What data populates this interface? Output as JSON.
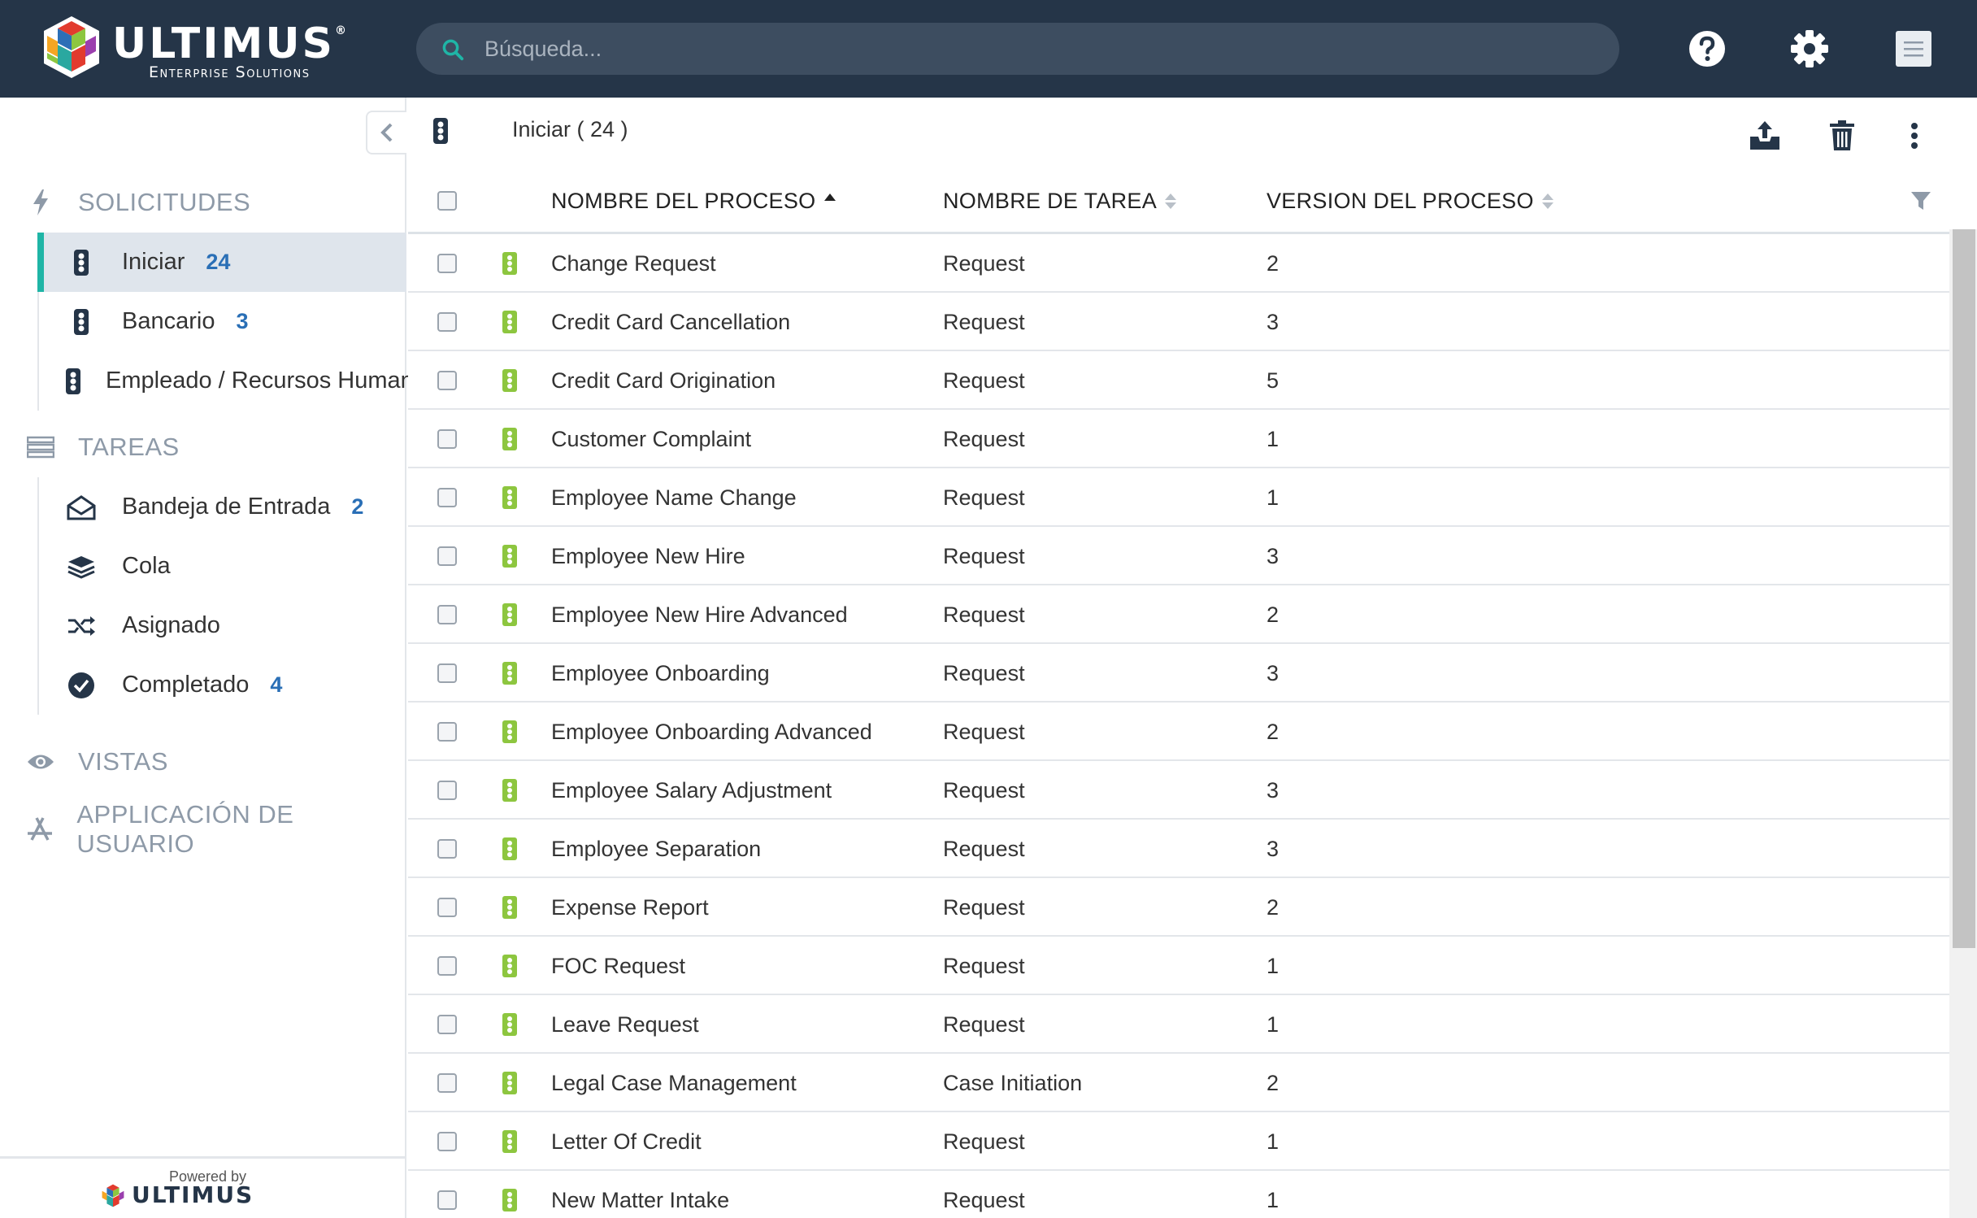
{
  "brand": {
    "name": "ULTIMUS",
    "tagline": "Enterprise Solutions",
    "powered_by": "Powered by",
    "powered_logo": "ULTIMUS"
  },
  "search": {
    "placeholder": "Búsqueda...",
    "value": ""
  },
  "header_icons": [
    "help-icon",
    "gear-icon",
    "menu-icon"
  ],
  "colors": {
    "topbar": "#253548",
    "accent": "#1fb5a6",
    "count": "#2a6fb6",
    "process_icon": "#8dc63f"
  },
  "sidebar": {
    "sections": [
      {
        "title": "SOLICITUDES",
        "icon": "bolt-icon"
      },
      {
        "title": "TAREAS",
        "icon": "tasks-icon"
      },
      {
        "title": "VISTAS",
        "icon": "eye-icon"
      },
      {
        "title": "APPLICACIÓN DE USUARIO",
        "icon": "app-store-icon"
      }
    ],
    "solicitudes": [
      {
        "label": "Iniciar",
        "count": "24",
        "icon": "traffic-light-icon",
        "active": true
      },
      {
        "label": "Bancario",
        "count": "3",
        "icon": "traffic-light-icon"
      },
      {
        "label": "Empleado / Recursos Humanos",
        "count": "",
        "icon": "traffic-light-icon"
      }
    ],
    "tareas": [
      {
        "label": "Bandeja de Entrada",
        "count": "2",
        "icon": "envelope-open-icon"
      },
      {
        "label": "Cola",
        "count": "",
        "icon": "layers-icon"
      },
      {
        "label": "Asignado",
        "count": "",
        "icon": "shuffle-icon"
      },
      {
        "label": "Completado",
        "count": "4",
        "icon": "check-circle-icon"
      }
    ]
  },
  "toolbar": {
    "title": "Iniciar ( 24 )",
    "actions": [
      "export-icon",
      "trash-icon",
      "more-vertical-icon"
    ]
  },
  "grid": {
    "columns": [
      "NOMBRE DEL PROCESO",
      "NOMBRE DE TAREA",
      "VERSION DEL PROCESO"
    ],
    "rows": [
      [
        "Change Request",
        "Request",
        "2"
      ],
      [
        "Credit Card Cancellation",
        "Request",
        "3"
      ],
      [
        "Credit Card Origination",
        "Request",
        "5"
      ],
      [
        "Customer Complaint",
        "Request",
        "1"
      ],
      [
        "Employee Name Change",
        "Request",
        "1"
      ],
      [
        "Employee New Hire",
        "Request",
        "3"
      ],
      [
        "Employee New Hire Advanced",
        "Request",
        "2"
      ],
      [
        "Employee Onboarding",
        "Request",
        "3"
      ],
      [
        "Employee Onboarding Advanced",
        "Request",
        "2"
      ],
      [
        "Employee Salary Adjustment",
        "Request",
        "3"
      ],
      [
        "Employee Separation",
        "Request",
        "3"
      ],
      [
        "Expense Report",
        "Request",
        "2"
      ],
      [
        "FOC Request",
        "Request",
        "1"
      ],
      [
        "Leave Request",
        "Request",
        "1"
      ],
      [
        "Legal Case Management",
        "Case Initiation",
        "2"
      ],
      [
        "Letter Of Credit",
        "Request",
        "1"
      ],
      [
        "New Matter Intake",
        "Request",
        "1"
      ]
    ]
  }
}
